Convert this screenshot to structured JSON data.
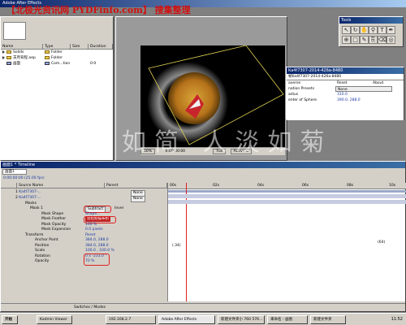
{
  "app": {
    "title": "Adobe After Effects"
  },
  "watermark_top": "【北极光资讯网 PYDFinfo.com】 搜集整理",
  "watermark_big": "心素如简  人淡如菊",
  "project": {
    "columns": [
      "Name",
      "Type",
      "Size",
      "Duration"
    ],
    "items": [
      {
        "name": "Solids",
        "type": "Folder",
        "size": "",
        "duration": ""
      },
      {
        "name": "羊月背程.aep",
        "type": "Folder",
        "size": "",
        "duration": ""
      },
      {
        "name": "画面",
        "type": "Com...tion",
        "size": "",
        "duration": "0:0"
      }
    ]
  },
  "comp_window": {
    "footer": {
      "zoom": "50%",
      "timecode": "0:00:00:00",
      "resolution": "Full",
      "camera": "Active C"
    }
  },
  "tools": {
    "title": "Tools"
  },
  "effects": {
    "title": "Ka4f7307-2014-426a-8480",
    "subtitle": "帧Ka4f7307-2014-426a-8480",
    "rows": [
      {
        "label": "averse",
        "value": "Reset",
        "extra": "About"
      },
      {
        "label": "nation Presets",
        "value": "None"
      },
      {
        "label": "adius",
        "value": "310.0"
      },
      {
        "label": "enter of Sphere",
        "value": "390.0, 288.0"
      }
    ]
  },
  "timeline": {
    "title": "画面1 * Timeline",
    "tab": "画面1",
    "timecode": "0:00:00:00 (25.00 fps)",
    "columns": [
      "Source Name",
      "Parent"
    ],
    "ruler": [
      "00s",
      "02s",
      "04s",
      "06s",
      "08s",
      "10s"
    ],
    "footer": "Switches / Modes",
    "rows": [
      {
        "num": "1",
        "name": "Ka4f7307-...",
        "parent": "None"
      },
      {
        "num": "2",
        "name": "Ka4f7307-...",
        "parent": "None"
      },
      {
        "num": "",
        "name": "Masks",
        "parent": ""
      },
      {
        "num": "",
        "name": "Mask 1",
        "mode": "Subtract",
        "inverted": "Inver"
      },
      {
        "num": "",
        "name": "Mask Shape",
        "value": "Shape..."
      },
      {
        "num": "",
        "name": "Mask Feather",
        "value": "羽化标描布积"
      },
      {
        "num": "",
        "name": "Mask Opacity",
        "value": "100 %"
      },
      {
        "num": "",
        "name": "Mask Expansion",
        "value": "0.0 pixels"
      },
      {
        "num": "",
        "name": "Transform",
        "value": "Reset"
      },
      {
        "num": "",
        "name": "Anchor Point",
        "value": "384.0, 288.0"
      },
      {
        "num": "",
        "name": "Position",
        "value": "384.0, 288.0"
      },
      {
        "num": "",
        "name": "Scale",
        "value": "100.0 , 100.0 %"
      },
      {
        "num": "",
        "name": "Rotation",
        "value": "0 x -233.0 °"
      },
      {
        "num": "",
        "name": "Opacity",
        "value": "70 %"
      }
    ],
    "key_left": "(.34)",
    "key_right": "(64)"
  },
  "taskbar": {
    "items": [
      "开始",
      "Kadmin Viewer",
      "192.168.2.7",
      "Adobe After Effects",
      "新建文件夹小 760 576...",
      "来命名 - 画图",
      "新建文件夹"
    ],
    "clock": "11:52"
  },
  "colors": {
    "accent": "#0a246a",
    "highlight": "#e02020"
  }
}
